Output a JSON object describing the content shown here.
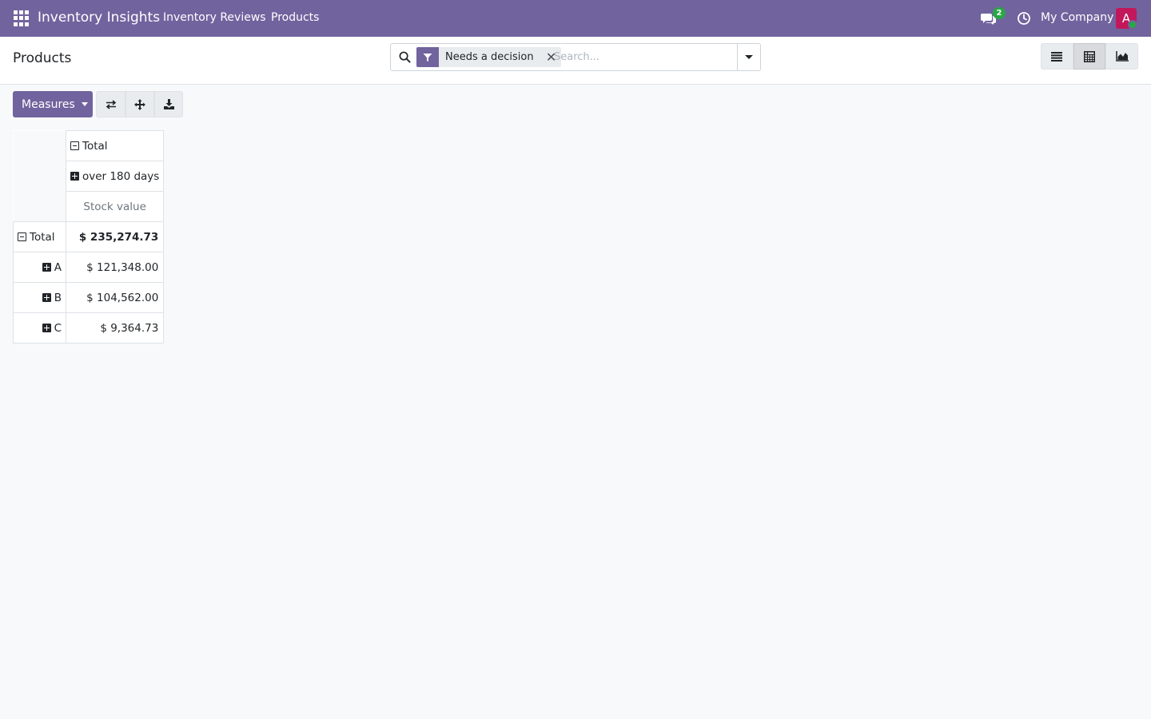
{
  "navbar": {
    "brand": "Inventory Insights",
    "menu": [
      "Inventory Reviews",
      "Products"
    ],
    "chat_count": "2",
    "company": "My Company",
    "avatar_letter": "A",
    "colors": {
      "brand": "#71639e",
      "avatar": "#c2185b",
      "online": "#28a745"
    }
  },
  "control_panel": {
    "title": "Products",
    "search": {
      "facet_label": "Needs a decision",
      "facet_icon": "filter-icon",
      "placeholder": "Search..."
    },
    "views": [
      {
        "name": "list-icon",
        "active": false
      },
      {
        "name": "pivot-icon",
        "active": true
      },
      {
        "name": "graph-icon",
        "active": false
      }
    ]
  },
  "pivot_toolbar": {
    "measures_label": "Measures",
    "icons": [
      "flip-axis-icon",
      "expand-icon",
      "download-icon"
    ]
  },
  "pivot": {
    "column_header_total": "Total",
    "column_header_group": "over 180 days",
    "measure": "Stock value",
    "rows": [
      {
        "label": "Total",
        "value": "$ 235,274.73"
      },
      {
        "label": "A",
        "value": "$ 121,348.00"
      },
      {
        "label": "B",
        "value": "$ 104,562.00"
      },
      {
        "label": "C",
        "value": "$ 9,364.73"
      }
    ]
  }
}
